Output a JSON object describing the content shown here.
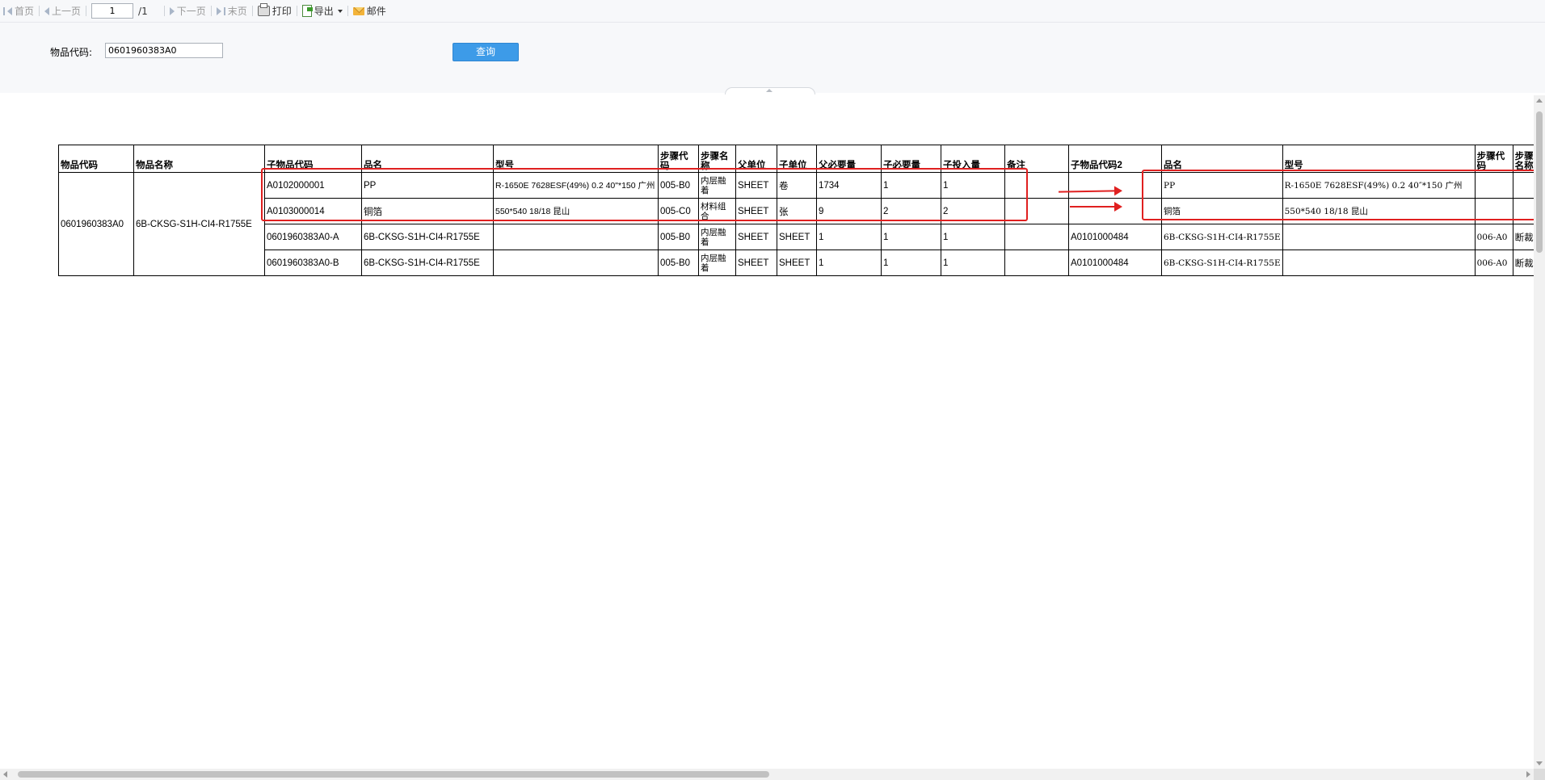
{
  "toolbar": {
    "first": "首页",
    "prev": "上一页",
    "page_value": "1",
    "total": "/1",
    "next": "下一页",
    "last": "末页",
    "print": "打印",
    "export": "导出",
    "mail": "邮件"
  },
  "query": {
    "label": "物品代码:",
    "value": "0601960383A0",
    "button": "查询"
  },
  "table": {
    "headers": [
      "物品代码",
      "物品名称",
      "子物品代码",
      "品名",
      "型号",
      "步骤代码",
      "步骤名称",
      "父单位",
      "子单位",
      "父必要量",
      "子必要量",
      "子投入量",
      "备注",
      "子物品代码2",
      "品名",
      "型号",
      "步骤代码",
      "步骤名称"
    ],
    "item_code": "0601960383A0",
    "item_name": "6B-CKSG-S1H-CI4-R1755E",
    "rows": [
      {
        "c2": "A0102000001",
        "c3": "PP",
        "c4": "R-1650E 7628ESF(49%) 0.2 40\"*150 广州",
        "c5": "005-B0",
        "c6": "内层融着",
        "c7": "SHEET",
        "c8": "卷",
        "c9": "1734",
        "c10": "1",
        "c11": "1",
        "c12": "",
        "c13": "",
        "c14": "PP",
        "c15": "R-1650E 7628ESF(49%) 0.2 40″*150 广州",
        "c16": "",
        "c17": ""
      },
      {
        "c2": "A0103000014",
        "c3": "铜箔",
        "c4": "550*540 18/18 昆山",
        "c5": "005-C0",
        "c6": "材料组合",
        "c7": "SHEET",
        "c8": "张",
        "c9": "9",
        "c10": "2",
        "c11": "2",
        "c12": "",
        "c13": "",
        "c14": "铜箔",
        "c15": "550*540 18/18 昆山",
        "c16": "",
        "c17": ""
      },
      {
        "c2": "0601960383A0-A",
        "c3": "6B-CKSG-S1H-CI4-R1755E",
        "c4": "",
        "c5": "005-B0",
        "c6": "内层融着",
        "c7": "SHEET",
        "c8": "SHEET",
        "c9": "1",
        "c10": "1",
        "c11": "1",
        "c12": "",
        "c13": "A0101000484",
        "c14": "6B-CKSG-S1H-CI4-R1755E",
        "c15": "",
        "c16": "006-A0",
        "c17": "断裁"
      },
      {
        "c2": "0601960383A0-B",
        "c3": "6B-CKSG-S1H-CI4-R1755E",
        "c4": "",
        "c5": "005-B0",
        "c6": "内层融着",
        "c7": "SHEET",
        "c8": "SHEET",
        "c9": "1",
        "c10": "1",
        "c11": "1",
        "c12": "",
        "c13": "A0101000484",
        "c14": "6B-CKSG-S1H-CI4-R1755E",
        "c15": "",
        "c16": "006-A0",
        "c17": "断裁"
      }
    ]
  },
  "colors": {
    "annotation": "#e02020",
    "query_button": "#3d9be8"
  }
}
